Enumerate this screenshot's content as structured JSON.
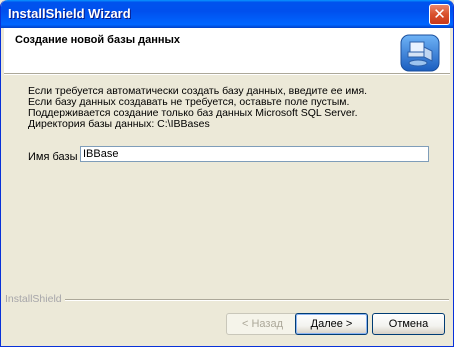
{
  "window": {
    "title": "InstallShield Wizard",
    "close_symbol": "✕"
  },
  "header": {
    "title": "Создание новой базы данных",
    "icon": "installshield-setup-icon"
  },
  "description": {
    "lines": [
      "Если требуется автоматически создать базу данных, введите ее имя.",
      "Если базу данных создавать не требуется, оставьте поле пустым.",
      "Поддерживается создание только баз данных Microsoft SQL Server.",
      "Директория базы данных: C:\\IBBases"
    ]
  },
  "form": {
    "db_name_label": "Имя базы",
    "db_name_value": "IBBase"
  },
  "footer": {
    "brand": "InstallShield",
    "back_label": "< Назад",
    "next_label": "Далее >",
    "cancel_label": "Отмена"
  },
  "colors": {
    "titlebar": "#0053EE",
    "dialog_bg": "#ECE9D8",
    "header_bg": "#FFFFFF"
  }
}
